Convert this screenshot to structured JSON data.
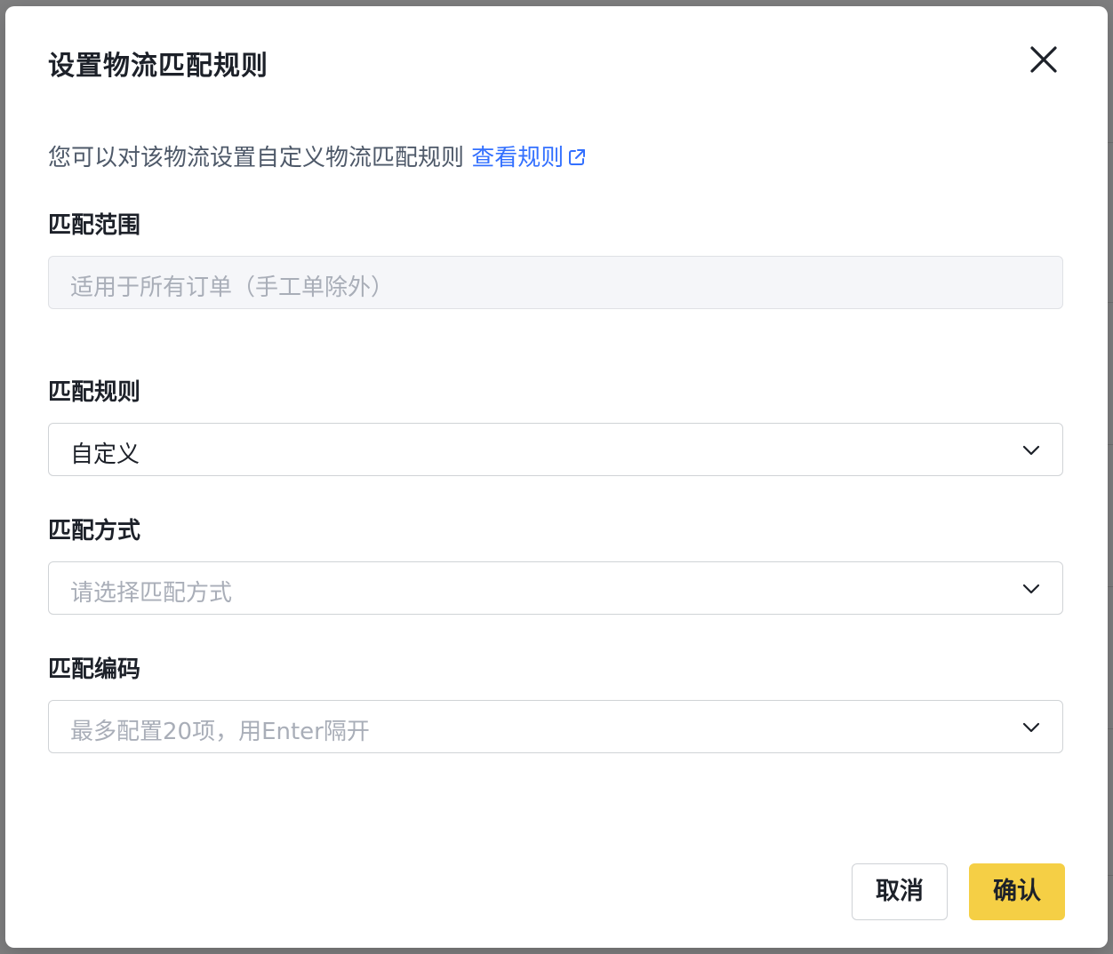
{
  "modal": {
    "title": "设置物流匹配规则",
    "description": "您可以对该物流设置自定义物流匹配规则",
    "rules_link": "查看规则"
  },
  "fields": {
    "scope": {
      "label": "匹配范围",
      "placeholder": "适用于所有订单（手工单除外）"
    },
    "rule": {
      "label": "匹配规则",
      "value": "自定义"
    },
    "method": {
      "label": "匹配方式",
      "placeholder": "请选择匹配方式"
    },
    "code": {
      "label": "匹配编码",
      "placeholder": "最多配置20项，用Enter隔开"
    }
  },
  "buttons": {
    "cancel": "取消",
    "confirm": "确认"
  },
  "colors": {
    "accent_link": "#3370ff",
    "confirm_button": "#f5cf45",
    "overlay": "#7f7f80"
  },
  "icons": {
    "close": "close-icon",
    "external_link": "external-link-icon",
    "dropdown": "chevron-down-icon"
  }
}
